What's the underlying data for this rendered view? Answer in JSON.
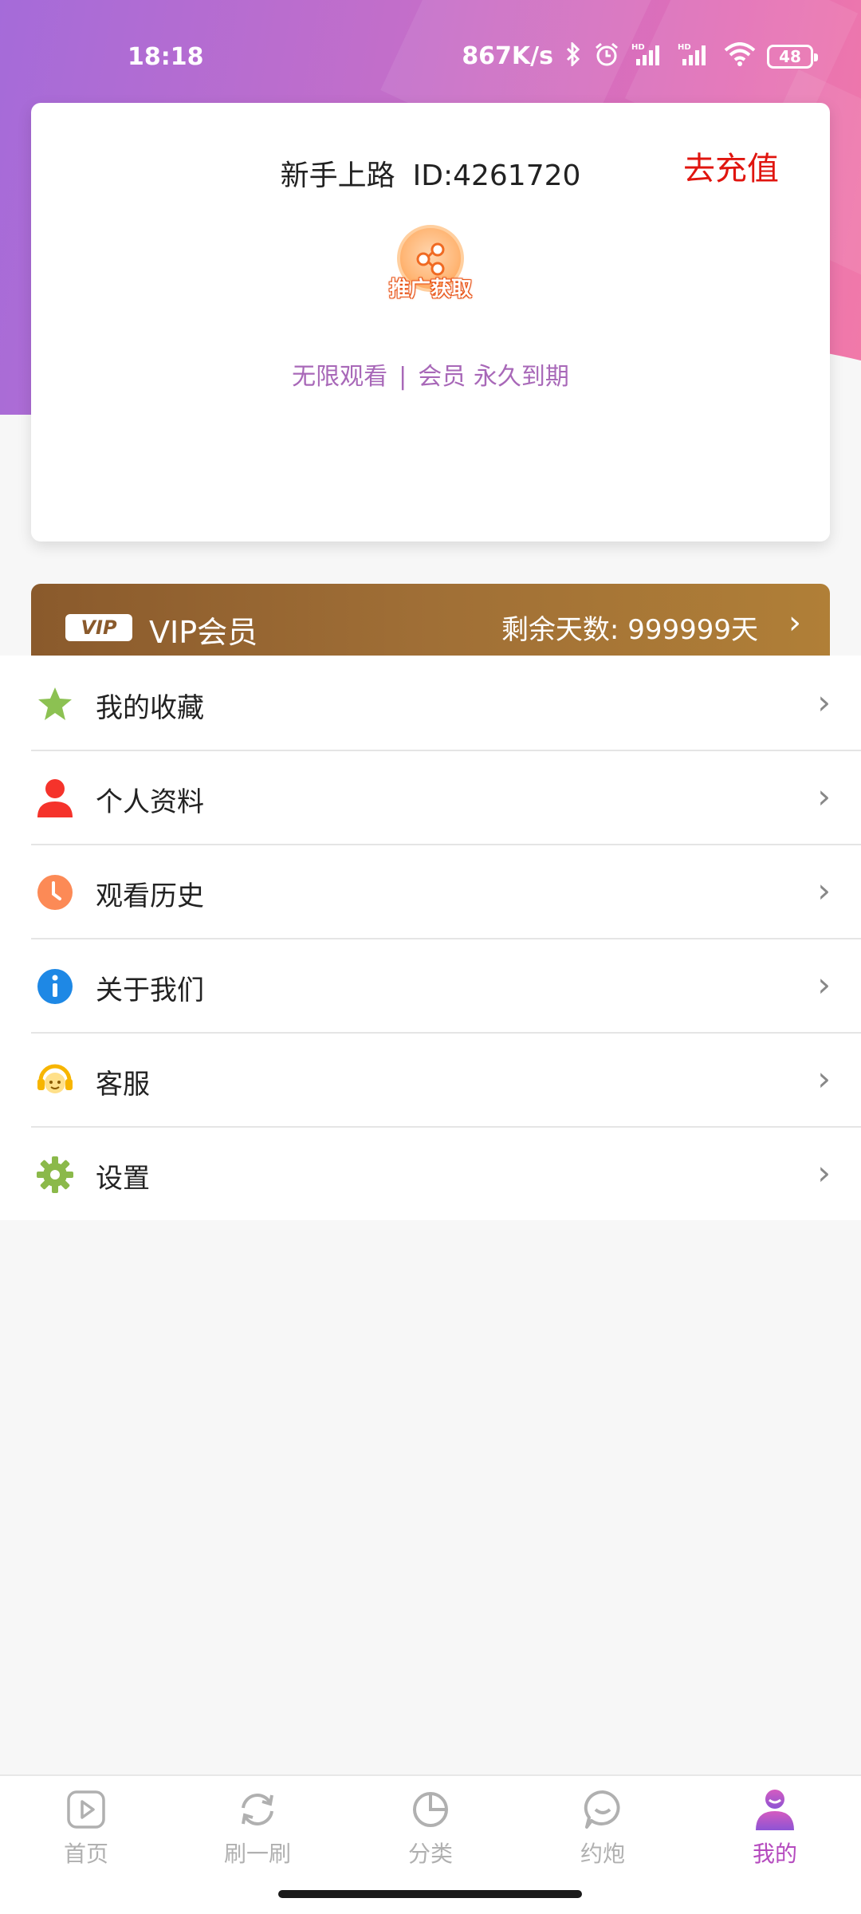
{
  "status_bar": {
    "time": "18:18",
    "network_speed": "867K/s",
    "battery": "48",
    "icons": [
      "bluetooth-icon",
      "alarm-icon",
      "hd-signal-icon",
      "hd-signal-icon",
      "wifi-icon",
      "battery-icon"
    ]
  },
  "profile": {
    "level": "新手上路",
    "id_text": "ID:4261720",
    "recharge": "去充值",
    "promo": "推广获取",
    "watch": "无限观看",
    "separator": "|",
    "membership": "会员 永久到期"
  },
  "vip": {
    "tag": "VIP",
    "title": "VIP会员",
    "remaining": "剩余天数: 999999天"
  },
  "menu": {
    "items": [
      {
        "label": "我的收藏",
        "icon": "star-icon",
        "color": "#8cc152"
      },
      {
        "label": "个人资料",
        "icon": "user-icon",
        "color": "#f5332b"
      },
      {
        "label": "观看历史",
        "icon": "clock-icon",
        "color": "#fc8a56"
      },
      {
        "label": "关于我们",
        "icon": "info-icon",
        "color": "#1e88e5"
      },
      {
        "label": "客服",
        "icon": "customer-service-icon",
        "color": "#f7b500"
      },
      {
        "label": "设置",
        "icon": "gear-icon",
        "color": "#8bb94a"
      }
    ]
  },
  "bottom_nav": {
    "items": [
      {
        "label": "首页",
        "icon": "play-icon"
      },
      {
        "label": "刷一刷",
        "icon": "refresh-icon"
      },
      {
        "label": "分类",
        "icon": "pie-chart-icon"
      },
      {
        "label": "约炮",
        "icon": "chat-icon"
      },
      {
        "label": "我的",
        "icon": "profile-icon",
        "active": true
      }
    ]
  },
  "colors": {
    "accent": "#b54bbf",
    "recharge": "#e0150f",
    "membership_text": "#a868b8",
    "vip_gold": "#a06f36"
  }
}
